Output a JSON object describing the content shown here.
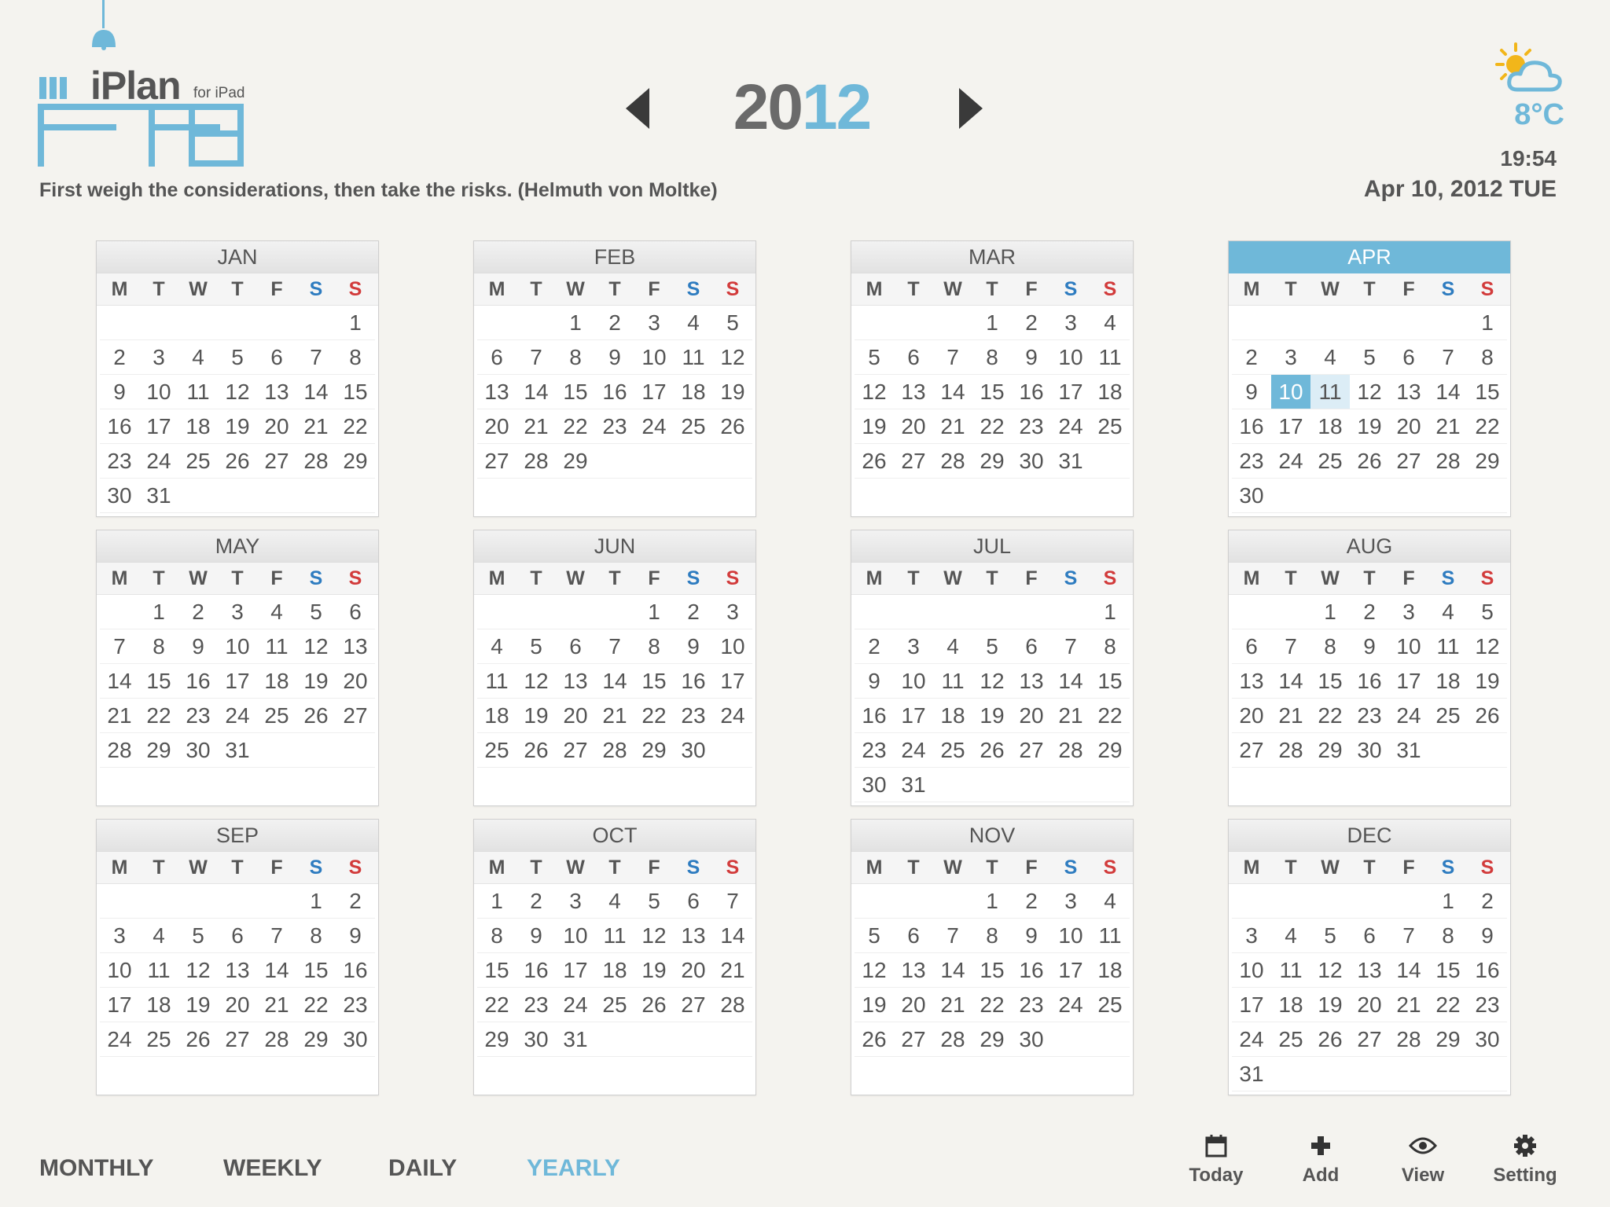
{
  "app": {
    "name": "iPlan",
    "sub": "for iPad",
    "quote": "First weigh the considerations, then take the risks. (Helmuth von Moltke)"
  },
  "year": {
    "prefix": "20",
    "suffix": "12"
  },
  "weather": {
    "temperature": "8°C",
    "icon": "partly-cloudy-icon"
  },
  "clock": "19:54",
  "date": "Apr 10, 2012 TUE",
  "weekdays": [
    "M",
    "T",
    "W",
    "T",
    "F",
    "S",
    "S"
  ],
  "today": {
    "month": 3,
    "day": 10,
    "highlight_day": 11
  },
  "colors": {
    "accent": "#6fb8d9",
    "saturday": "#2e7cc0",
    "sunday": "#d23b3b",
    "text": "#555555"
  },
  "months": [
    {
      "name": "JAN",
      "offset": 6,
      "days": 31
    },
    {
      "name": "FEB",
      "offset": 2,
      "days": 29
    },
    {
      "name": "MAR",
      "offset": 3,
      "days": 31
    },
    {
      "name": "APR",
      "offset": 6,
      "days": 30
    },
    {
      "name": "MAY",
      "offset": 1,
      "days": 31
    },
    {
      "name": "JUN",
      "offset": 4,
      "days": 30
    },
    {
      "name": "JUL",
      "offset": 6,
      "days": 31
    },
    {
      "name": "AUG",
      "offset": 2,
      "days": 31
    },
    {
      "name": "SEP",
      "offset": 5,
      "days": 30
    },
    {
      "name": "OCT",
      "offset": 0,
      "days": 31
    },
    {
      "name": "NOV",
      "offset": 3,
      "days": 30
    },
    {
      "name": "DEC",
      "offset": 5,
      "days": 31
    }
  ],
  "views": {
    "monthly": "MONTHLY",
    "weekly": "WEEKLY",
    "daily": "DAILY",
    "yearly": "YEARLY",
    "active": "yearly"
  },
  "toolbar": {
    "today": "Today",
    "add": "Add",
    "view": "View",
    "setting": "Setting"
  }
}
